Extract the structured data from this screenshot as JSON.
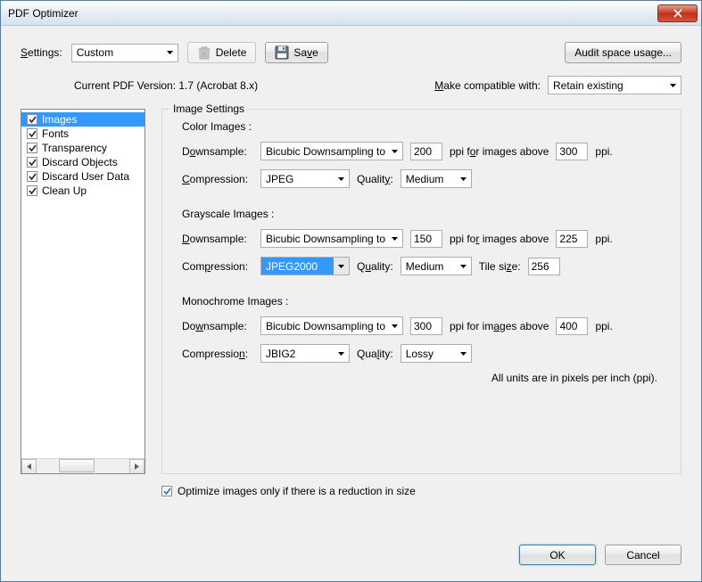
{
  "title": "PDF Optimizer",
  "toolbar": {
    "settings_label": "Settings:",
    "settings_value": "Custom",
    "delete_label": "Delete",
    "save_label": "Save",
    "audit_label": "Audit space usage..."
  },
  "info": {
    "version_label": "Current PDF Version: 1.7 (Acrobat 8.x)",
    "compat_label": "Make compatible with:",
    "compat_value": "Retain existing"
  },
  "sidebar": {
    "items": [
      {
        "label": "Images",
        "checked": true,
        "selected": true
      },
      {
        "label": "Fonts",
        "checked": true
      },
      {
        "label": "Transparency",
        "checked": true
      },
      {
        "label": "Discard Objects",
        "checked": true
      },
      {
        "label": "Discard User Data",
        "checked": true
      },
      {
        "label": "Clean Up",
        "checked": true
      }
    ]
  },
  "panel": {
    "legend": "Image Settings",
    "color": {
      "title": "Color Images :",
      "downsample_label": "Downsample:",
      "downsample_value": "Bicubic Downsampling to",
      "ppi1": "200",
      "above_label": "ppi for images above",
      "ppi2": "300",
      "ppi_suffix": "ppi.",
      "compression_label": "Compression:",
      "compression_value": "JPEG",
      "quality_label": "Quality:",
      "quality_value": "Medium"
    },
    "gray": {
      "title": "Grayscale Images :",
      "downsample_label": "Downsample:",
      "downsample_value": "Bicubic Downsampling to",
      "ppi1": "150",
      "above_label": "ppi for images above",
      "ppi2": "225",
      "ppi_suffix": "ppi.",
      "compression_label": "Compression:",
      "compression_value": "JPEG2000",
      "quality_label": "Quality:",
      "quality_value": "Medium",
      "tilesize_label": "Tile size:",
      "tilesize_value": "256"
    },
    "mono": {
      "title": "Monochrome Images :",
      "downsample_label": "Downsample:",
      "downsample_value": "Bicubic Downsampling to",
      "ppi1": "300",
      "above_label": "ppi for images above",
      "ppi2": "400",
      "ppi_suffix": "ppi.",
      "compression_label": "Compression:",
      "compression_value": "JBIG2",
      "quality_label": "Quality:",
      "quality_value": "Lossy"
    },
    "note": "All units are in pixels per inch (ppi)."
  },
  "optimize_check": {
    "label": "Optimize images only if there is a reduction in size",
    "checked": true
  },
  "footer": {
    "ok": "OK",
    "cancel": "Cancel"
  }
}
